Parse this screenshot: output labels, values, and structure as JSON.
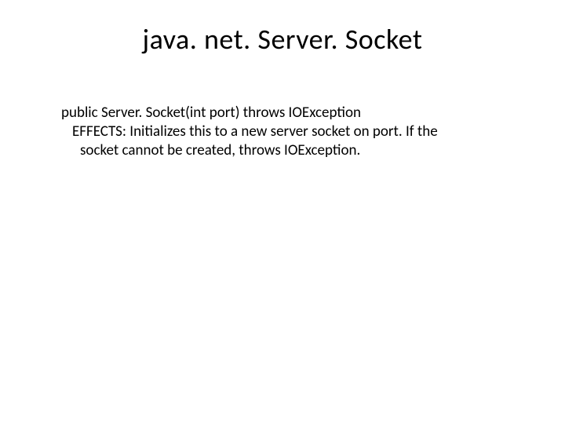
{
  "slide": {
    "title": "java. net. Server. Socket",
    "body": {
      "line1": "public Server. Socket(int port) throws IOException",
      "line2": "EFFECTS: Initializes this to a new server socket on port.  If the",
      "line3": "socket cannot be created, throws IOException."
    }
  }
}
